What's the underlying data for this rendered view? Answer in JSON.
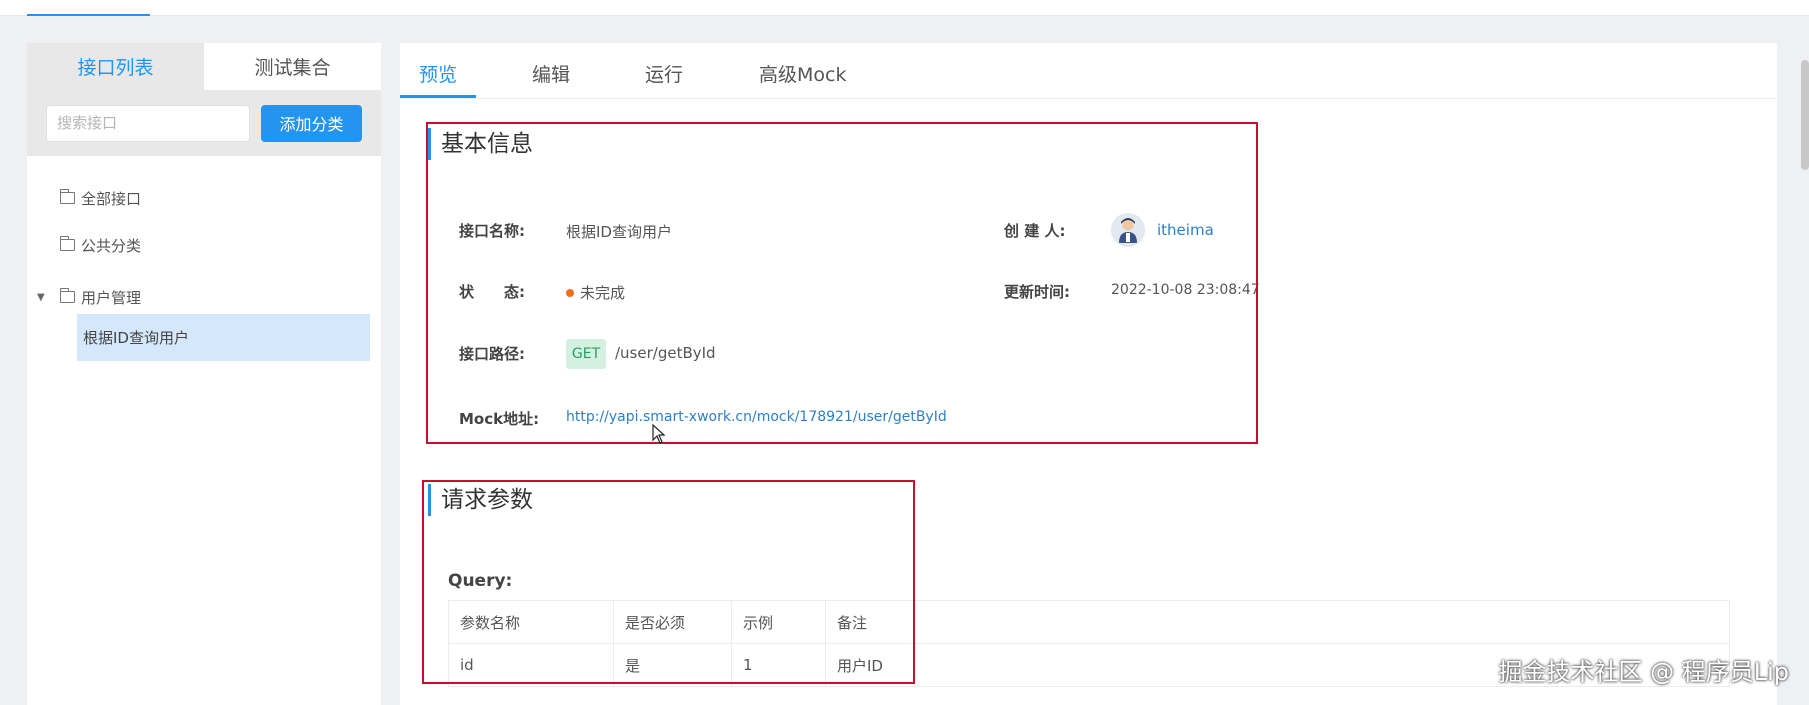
{
  "sidebar": {
    "tabs": [
      {
        "label": "接口列表",
        "active": true
      },
      {
        "label": "测试集合",
        "active": false
      }
    ],
    "search_placeholder": "搜索接口",
    "add_button": "添加分类",
    "tree": {
      "all": "全部接口",
      "public": "公共分类",
      "group": "用户管理",
      "leaf": "根据ID查询用户"
    }
  },
  "main": {
    "tabs": [
      "预览",
      "编辑",
      "运行",
      "高级Mock"
    ],
    "basic": {
      "title": "基本信息",
      "name_label": "接口名称:",
      "name_value": "根据ID查询用户",
      "creator_label": "创 建 人:",
      "creator_value": "itheima",
      "status_label": "状　　态:",
      "status_value": "未完成",
      "updated_label": "更新时间:",
      "updated_value": "2022-10-08 23:08:47",
      "path_label": "接口路径:",
      "method": "GET",
      "path_value": "/user/getById",
      "mock_label": "Mock地址:",
      "mock_value": "http://yapi.smart-xwork.cn/mock/178921/user/getById"
    },
    "request": {
      "title": "请求参数",
      "query_label": "Query:",
      "headers": [
        "参数名称",
        "是否必须",
        "示例",
        "备注"
      ],
      "rows": [
        [
          "id",
          "是",
          "1",
          "用户ID"
        ]
      ]
    }
  },
  "watermark": "掘金技术社区 @ 程序员Lip",
  "colors": {
    "accent": "#2395f1",
    "highlight_box": "#c8102e",
    "status_dot": "#f56c1d"
  }
}
